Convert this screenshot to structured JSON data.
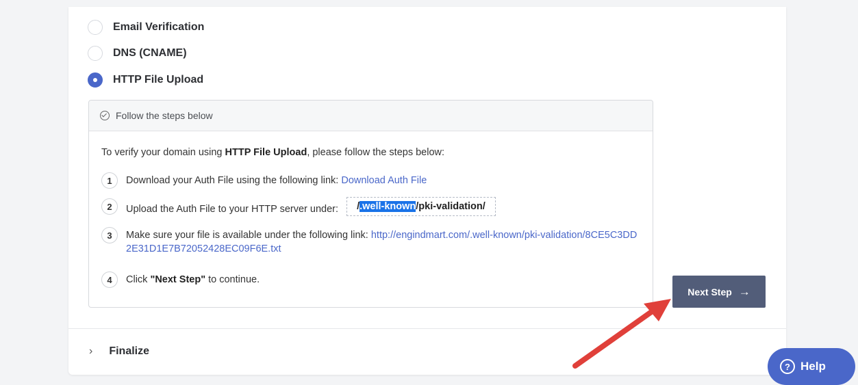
{
  "methods": [
    {
      "label": "Email Verification",
      "checked": false
    },
    {
      "label": "DNS (CNAME)",
      "checked": false
    },
    {
      "label": "HTTP File Upload",
      "checked": true
    }
  ],
  "steps_box": {
    "header": "Follow the steps below",
    "intro_prefix": "To verify your domain using",
    "intro_method": "HTTP File Upload",
    "intro_suffix": ", please follow the steps below:",
    "steps": [
      {
        "number": "1",
        "text": "Download your Auth File using the following link:",
        "link": "Download Auth File"
      },
      {
        "number": "2",
        "text": "Upload the Auth File to your HTTP server under:",
        "path_prefix": "/",
        "path_selected": ".well-known",
        "path_suffix": "/pki-validation/"
      },
      {
        "number": "3",
        "text": "Make sure your file is available under the following link:",
        "link": "http://engindmart.com/.well-known/pki-validation/8CE5C3DD2E31D1E7B72052428EC09F6E.txt"
      },
      {
        "number": "4",
        "text_prefix": "Click",
        "strong": "\"Next Step\"",
        "text_suffix": "to continue."
      }
    ]
  },
  "next_button": {
    "label": "Next Step",
    "icon": "arrow-right-icon"
  },
  "finalize": {
    "label": "Finalize",
    "icon": "chevron-right-icon"
  },
  "help_button": {
    "label": "Help",
    "icon": "question-circle-icon"
  },
  "colors": {
    "accent": "#4a67c9",
    "button": "#525d79",
    "annotation_arrow": "#e0403a",
    "selection": "#1a73e8"
  }
}
